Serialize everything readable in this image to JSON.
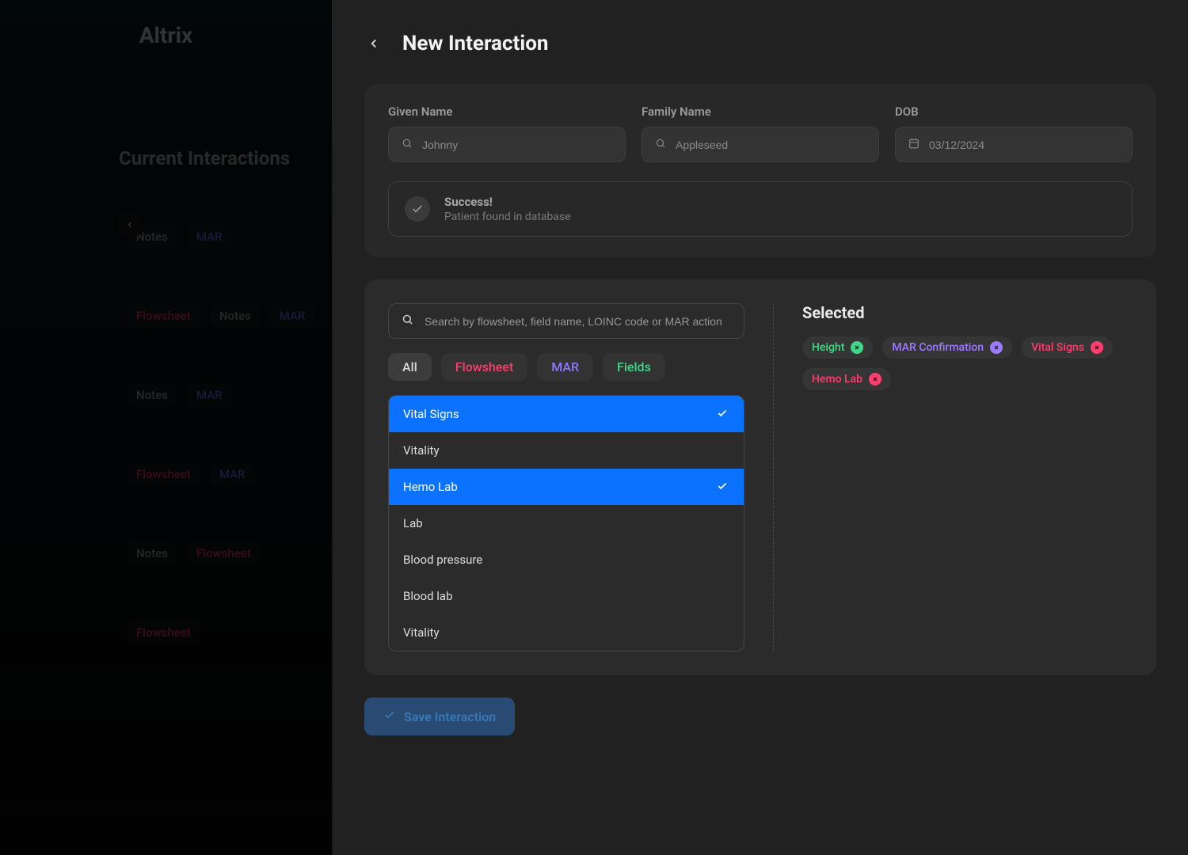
{
  "brand": "Altrix",
  "sidebar": {
    "section_title": "Current Interactions",
    "cards": [
      {
        "tags": [
          "Notes",
          "MAR"
        ]
      },
      {
        "tags": [
          "Flowsheet",
          "Notes",
          "MAR"
        ]
      },
      {
        "tags": [
          "Notes",
          "MAR"
        ]
      },
      {
        "tags": [
          "Flowsheet",
          "MAR"
        ]
      },
      {
        "tags": [
          "Notes",
          "Flowsheet"
        ]
      },
      {
        "tags": [
          "Flowsheet"
        ]
      }
    ]
  },
  "modal": {
    "title": "New Interaction",
    "form": {
      "given_name_label": "Given Name",
      "given_name_placeholder": "Johnny",
      "family_name_label": "Family Name",
      "family_name_placeholder": "Appleseed",
      "dob_label": "DOB",
      "dob_placeholder": "03/12/2024"
    },
    "success": {
      "title": "Success!",
      "subtitle": "Patient found in database"
    },
    "picker": {
      "search_placeholder": "Search by flowsheet, field name, LOINC code or MAR action",
      "filters": {
        "all": "All",
        "flowsheet": "Flowsheet",
        "mar": "MAR",
        "fields": "Fields"
      },
      "list": [
        {
          "label": "Vital Signs",
          "selected": true
        },
        {
          "label": "Vitality",
          "selected": false
        },
        {
          "label": "Hemo Lab",
          "selected": true
        },
        {
          "label": "Lab",
          "selected": false
        },
        {
          "label": "Blood pressure",
          "selected": false
        },
        {
          "label": "Blood lab",
          "selected": false
        },
        {
          "label": "Vitality",
          "selected": false
        }
      ],
      "selected_title": "Selected",
      "selected_chips": [
        {
          "label": "Height",
          "color": "green"
        },
        {
          "label": "MAR Confirmation",
          "color": "purple"
        },
        {
          "label": "Vital Signs",
          "color": "red"
        },
        {
          "label": "Hemo Lab",
          "color": "red"
        }
      ]
    },
    "save_label": "Save Interaction"
  },
  "tag_colors": {
    "Flowsheet": "flowsheet",
    "Notes": "notes",
    "MAR": "mar"
  }
}
